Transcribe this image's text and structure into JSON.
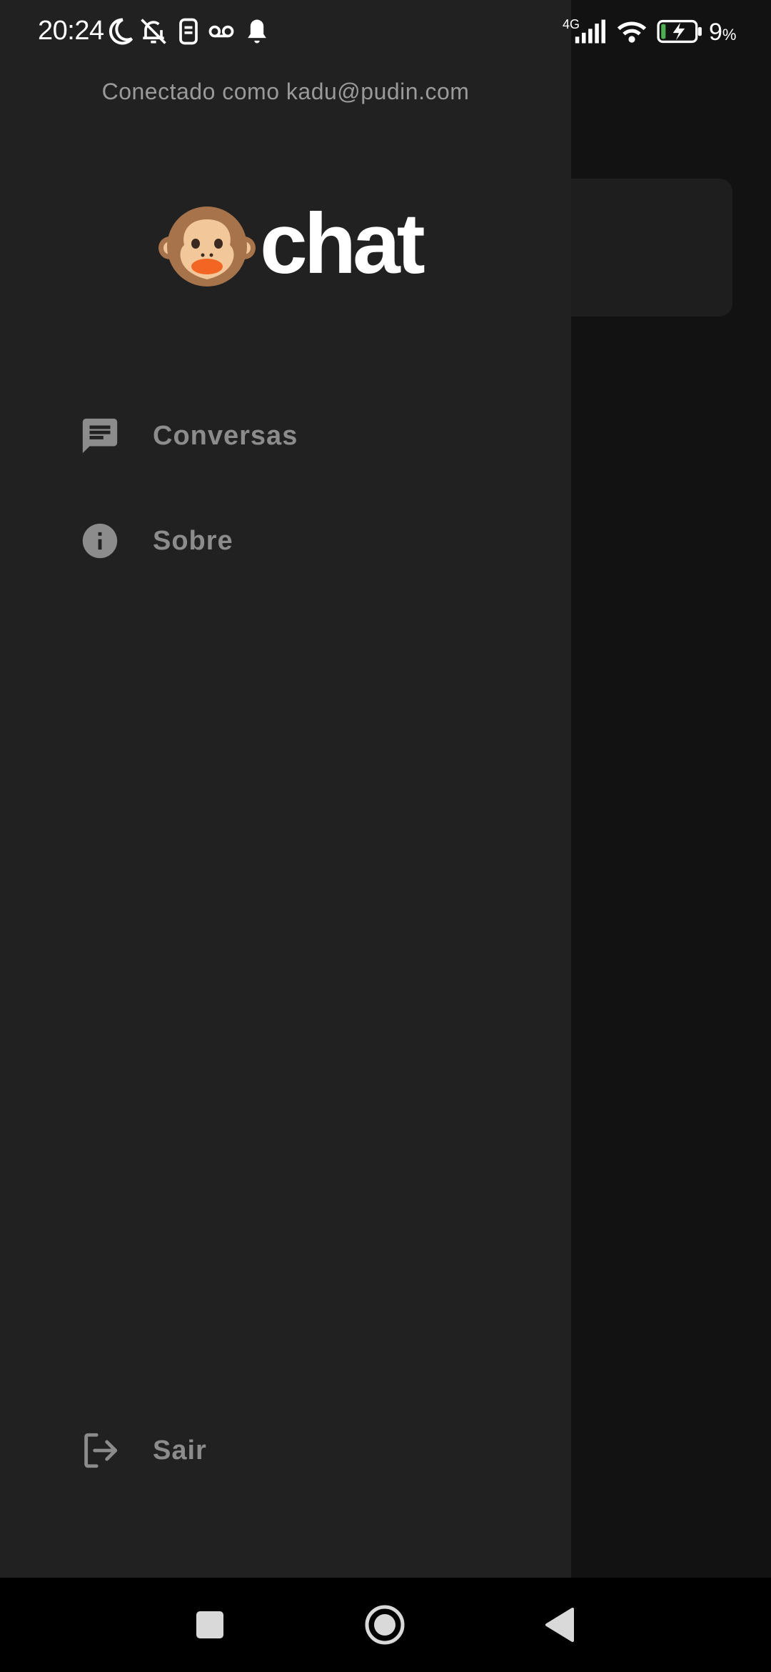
{
  "status_bar": {
    "time": "20:24",
    "network_type": "4G",
    "battery_percent": "9",
    "battery_unit": "%",
    "icons": [
      "moon-icon",
      "bell-off-icon",
      "sim-icon",
      "voicemail-icon",
      "bell-icon",
      "signal-icon",
      "wifi-icon",
      "battery-charging-icon"
    ]
  },
  "drawer": {
    "connected_as": "Conectado como kadu@pudin.com",
    "logo": {
      "emoji": "monkey-face",
      "text": "chat"
    },
    "items": [
      {
        "label": "Conversas",
        "icon": "chat-icon"
      },
      {
        "label": "Sobre",
        "icon": "info-icon"
      }
    ],
    "logout": {
      "label": "Sair",
      "icon": "logout-icon"
    }
  },
  "colors": {
    "drawer_bg": "#212121",
    "screen_bg": "#121212",
    "menu_text": "#8c8c8c",
    "connected_text": "#9a9a9a",
    "logo_text": "#ffffff",
    "battery_accent": "#4caf50"
  },
  "nav_bar": {
    "buttons": [
      "recent-apps-button",
      "home-button",
      "back-button"
    ]
  }
}
